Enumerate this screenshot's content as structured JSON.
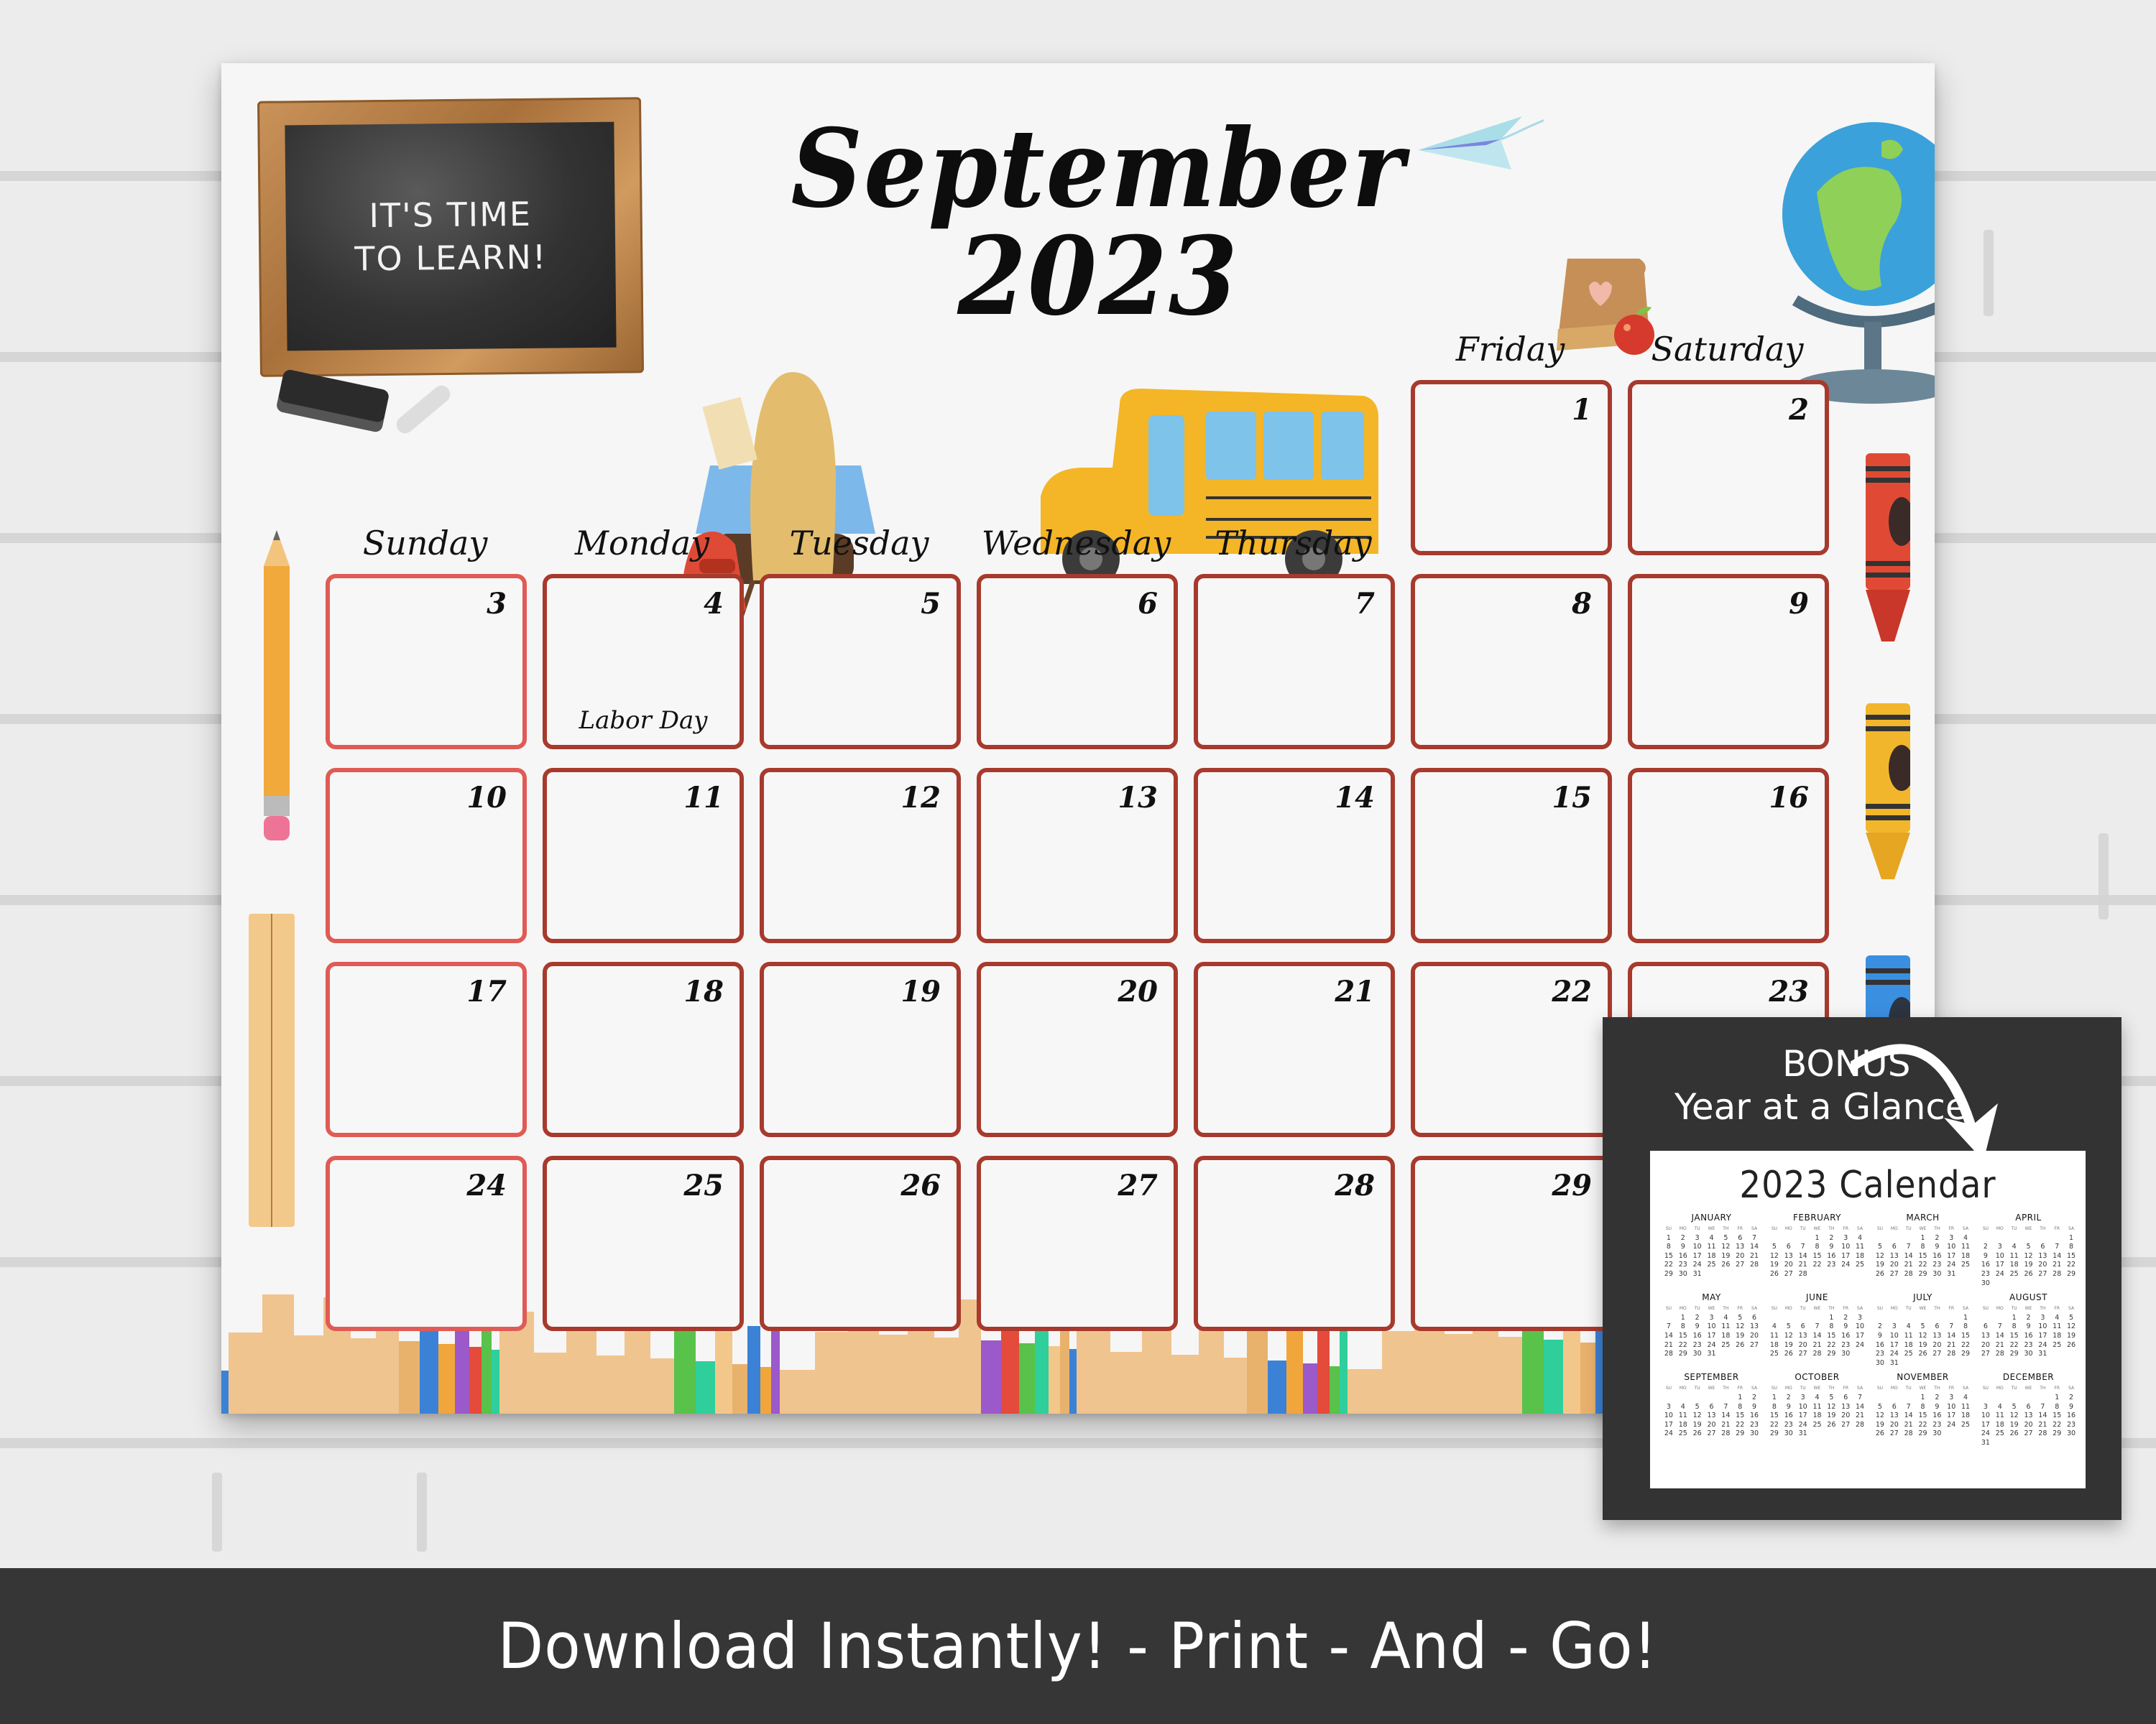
{
  "page": {
    "banner_text": "Download Instantly! - Print - And - Go!"
  },
  "calendar": {
    "title": "September 2023",
    "chalkboard": {
      "line1": "It's time",
      "line2": "to learn!"
    },
    "weekdays": [
      "Sunday",
      "Monday",
      "Tuesday",
      "Wednesday",
      "Thursday",
      "Friday",
      "Saturday"
    ],
    "first_weekday_index": 5,
    "days_in_month": 30,
    "highlight_weekday_index": 0,
    "holidays": [
      {
        "day": 4,
        "label": "Labor Day"
      }
    ],
    "colors": {
      "cell_border": "#a73a2d",
      "sunday_border": "#e05b55"
    }
  },
  "decorations": [
    "chalkboard-icon",
    "eraser-icon",
    "chalk-icon",
    "paper-plane-icon",
    "lunch-bag-icon",
    "apple-icon",
    "globe-icon",
    "school-desk-icon",
    "backpack-icon",
    "school-bus-icon",
    "pencil-icon",
    "ruler-icon",
    "red-crayon-icon",
    "yellow-crayon-icon",
    "blue-crayon-icon",
    "books-icon"
  ],
  "bonus": {
    "line1": "BONUS",
    "line2": "Year at a Glance",
    "sheet_title": "2023 Calendar",
    "weekday_abbr": [
      "SU",
      "MO",
      "TU",
      "WE",
      "TH",
      "FR",
      "SA"
    ],
    "months": [
      {
        "name": "January",
        "start": 0,
        "days": 31
      },
      {
        "name": "February",
        "start": 3,
        "days": 28
      },
      {
        "name": "March",
        "start": 3,
        "days": 31
      },
      {
        "name": "April",
        "start": 6,
        "days": 30
      },
      {
        "name": "May",
        "start": 1,
        "days": 31
      },
      {
        "name": "June",
        "start": 4,
        "days": 30
      },
      {
        "name": "July",
        "start": 6,
        "days": 31
      },
      {
        "name": "August",
        "start": 2,
        "days": 31
      },
      {
        "name": "September",
        "start": 5,
        "days": 30
      },
      {
        "name": "October",
        "start": 0,
        "days": 31
      },
      {
        "name": "November",
        "start": 3,
        "days": 30
      },
      {
        "name": "December",
        "start": 5,
        "days": 31
      }
    ]
  }
}
